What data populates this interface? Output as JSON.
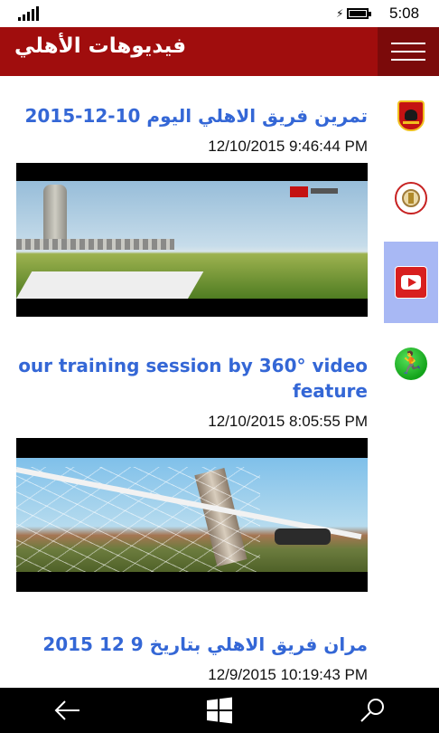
{
  "status_bar": {
    "time": "5:08",
    "icons": [
      "signal-icon",
      "charging-icon",
      "battery-icon"
    ]
  },
  "header": {
    "title": "فيديوهات الأهلي",
    "menu_icon": "hamburger-icon",
    "bg_color": "#a00d0d"
  },
  "side_nav": {
    "items": [
      {
        "name": "al-ahly-club",
        "icon": "al-ahly-logo-icon",
        "active": false
      },
      {
        "name": "league",
        "icon": "league-badge-icon",
        "active": false
      },
      {
        "name": "videos",
        "icon": "youtube-icon",
        "active": true
      },
      {
        "name": "training",
        "icon": "runner-icon",
        "active": false
      }
    ],
    "active_color": "#a8b8f4"
  },
  "feed": {
    "items": [
      {
        "title": "تمرين فريق الاهلي اليوم 10-12-2015",
        "date": "12/10/2015 9:46:44 PM",
        "thumbnail": "stadium-video-thumbnail"
      },
      {
        "title": "our training session by 360° video feature",
        "date": "12/10/2015 8:05:55 PM",
        "thumbnail": "goal-net-video-thumbnail"
      },
      {
        "title": "مران فريق الاهلي  بتاريخ  9 12 2015",
        "date": "12/9/2015 10:19:43 PM",
        "thumbnail": ""
      }
    ],
    "title_color": "#3467d6"
  },
  "bottom_bar": {
    "buttons": [
      "back-arrow-icon",
      "windows-start-icon",
      "search-icon"
    ]
  }
}
